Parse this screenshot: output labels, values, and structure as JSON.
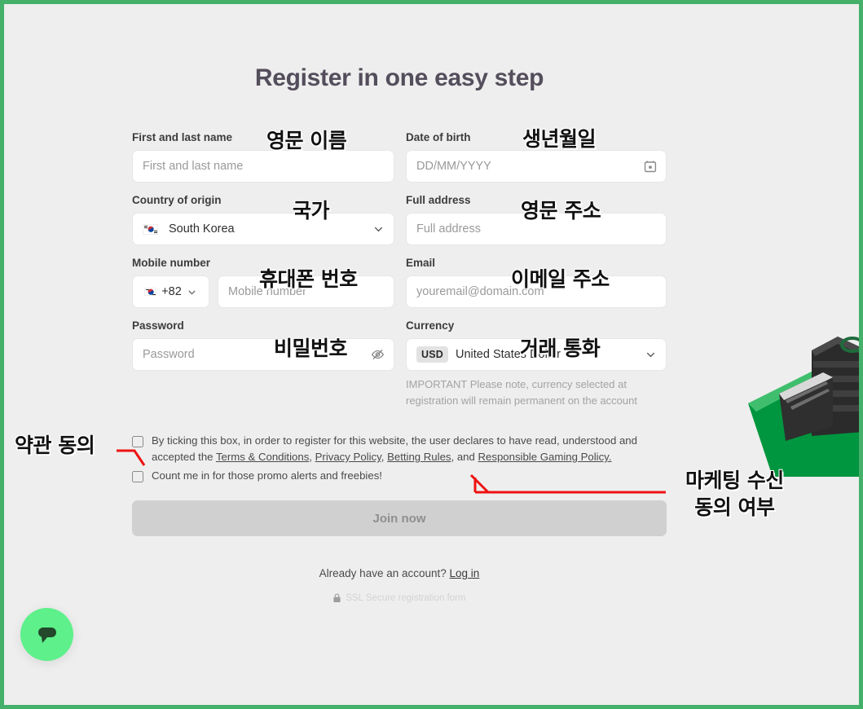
{
  "page": {
    "title": "Register in one easy step",
    "background_color": "#eeeeee",
    "border_color": "#44b06a",
    "title_color": "#544e5c"
  },
  "form": {
    "fields": {
      "name": {
        "label": "First and last name",
        "placeholder": "First and last name",
        "value": ""
      },
      "dob": {
        "label": "Date of birth",
        "placeholder": "DD/MM/YYYY",
        "value": "",
        "icon": "calendar-icon"
      },
      "country": {
        "label": "Country of origin",
        "value": "South Korea",
        "icon": "chevron-down-icon",
        "flag": "south-korea-flag"
      },
      "address": {
        "label": "Full address",
        "placeholder": "Full address",
        "value": ""
      },
      "mobile": {
        "label": "Mobile number",
        "placeholder": "Mobile number",
        "value": "",
        "dial_code": "+82",
        "flag": "south-korea-flag"
      },
      "email": {
        "label": "Email",
        "placeholder": "youremail@domain.com",
        "value": ""
      },
      "password": {
        "label": "Password",
        "placeholder": "Password",
        "value": "",
        "icon": "eye-off-icon"
      },
      "currency": {
        "label": "Currency",
        "badge": "USD",
        "value": "United States Dollar",
        "icon": "chevron-down-icon"
      }
    },
    "currency_note": "IMPORTANT Please note, currency selected at registration will remain permanent on the account",
    "terms": {
      "intro": "By ticking this box, in order to register for this website, the user declares to have read, understood and accepted the ",
      "links": [
        "Terms & Conditions",
        "Privacy Policy",
        "Betting Rules",
        "Responsible Gaming Policy."
      ],
      "sep1": ", ",
      "sep2": ", ",
      "sep3": ", and ",
      "checked": false
    },
    "promo": {
      "text": "Count me in for those promo alerts and freebies!",
      "checked": false
    },
    "submit": {
      "label": "Join now",
      "disabled": true,
      "color": "#d0d0d0",
      "text_color": "#8f8f8f"
    },
    "login_prompt": "Already have an account?",
    "login_link": "Log in",
    "ssl_text": "SSL Secure registration form",
    "ssl_icon": "lock-icon"
  },
  "annotations": {
    "color": "#111111",
    "arrow_color": "#ee1111",
    "name": "영문 이름",
    "dob": "생년월일",
    "country": "국가",
    "address": "영문 주소",
    "mobile": "휴대폰 번호",
    "email": "이메일 주소",
    "password": "비밀번호",
    "currency": "거래 통화",
    "terms": "약관 동의",
    "marketing_line1": "마케팅 수신",
    "marketing_line2": "동의 여부"
  },
  "chat": {
    "icon": "chat-bubble-icon",
    "color": "#5ef08a",
    "bubble_color": "#23482c"
  }
}
